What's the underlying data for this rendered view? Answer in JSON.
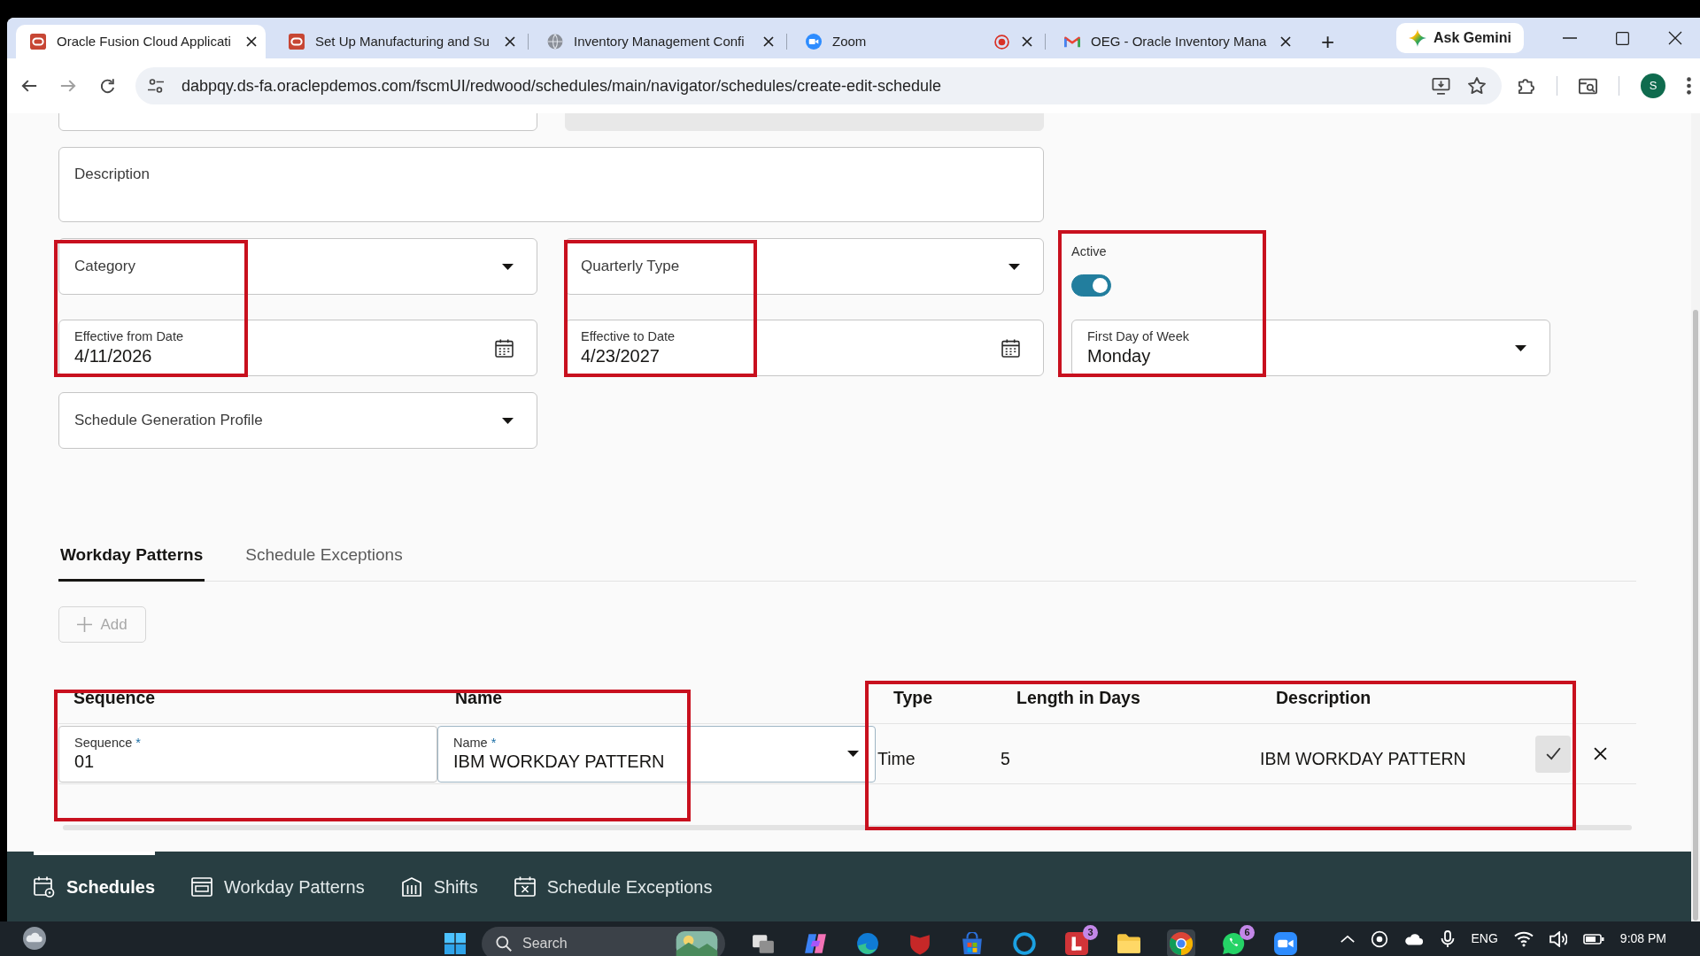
{
  "browser": {
    "tabs": [
      {
        "title": "Oracle Fusion Cloud Applicati",
        "kind": "oracle",
        "selected": true,
        "recording": false
      },
      {
        "title": "Set Up Manufacturing and Su",
        "kind": "oracle",
        "selected": false,
        "recording": false
      },
      {
        "title": "Inventory Management Confi",
        "kind": "globe",
        "selected": false,
        "recording": false
      },
      {
        "title": "Zoom",
        "kind": "zoom",
        "selected": false,
        "recording": true
      },
      {
        "title": "OEG - Oracle Inventory Mana",
        "kind": "mail",
        "selected": false,
        "recording": false
      }
    ],
    "new_tab": "+",
    "gemini_button": "Ask Gemini",
    "address": "dabpqy.ds-fa.oraclepdemos.com/fscmUI/redwood/schedules/main/navigator/schedules/create-edit-schedule",
    "profile_initial": "S"
  },
  "form": {
    "rows": [
      {
        "fields": [
          {
            "kind": "text",
            "disabled": false
          },
          {
            "kind": "text",
            "disabled": true
          }
        ]
      },
      {
        "fields": [
          {
            "kind": "textarea",
            "label": "Description"
          }
        ]
      },
      {
        "fields": [
          {
            "kind": "select",
            "label": "Category"
          },
          {
            "kind": "select",
            "label": "Quarterly Type"
          },
          {
            "kind": "toggle",
            "label": "Active",
            "on": true
          }
        ]
      },
      {
        "fields": [
          {
            "kind": "date",
            "label": "Effective from Date",
            "value": "4/11/2026"
          },
          {
            "kind": "date",
            "label": "Effective to Date",
            "value": "4/23/2027"
          },
          {
            "kind": "select",
            "label": "First Day of Week",
            "value": "Monday"
          }
        ]
      },
      {
        "fields": [
          {
            "kind": "select",
            "label": "Schedule Generation Profile"
          }
        ]
      }
    ]
  },
  "tabs": [
    {
      "label": "Workday Patterns",
      "selected": true
    },
    {
      "label": "Schedule Exceptions",
      "selected": false
    }
  ],
  "add_button": {
    "label": "Add",
    "disabled": true
  },
  "table": {
    "columns": [
      "Sequence",
      "Name",
      "Type",
      "Length in Days",
      "Description"
    ],
    "rows": [
      {
        "cells": [
          {
            "kind": "input",
            "label": "Sequence",
            "required_mark": "*",
            "value": "01"
          },
          {
            "kind": "select",
            "label": "Name",
            "required_mark": "*",
            "value": "IBM WORKDAY PATTERN"
          },
          {
            "kind": "text",
            "value": "Time"
          },
          {
            "kind": "text",
            "value": "5"
          },
          {
            "kind": "text",
            "value": "IBM WORKDAY PATTERN"
          }
        ]
      }
    ]
  },
  "bottom_nav": [
    {
      "label": "Schedules",
      "kind": "schedule",
      "selected": true
    },
    {
      "label": "Workday Patterns",
      "kind": "pattern",
      "selected": false
    },
    {
      "label": "Shifts",
      "kind": "shift",
      "selected": false
    },
    {
      "label": "Schedule Exceptions",
      "kind": "exception",
      "selected": false
    }
  ],
  "taskbar": {
    "search_placeholder": "Search",
    "apps": [
      {
        "kind": "taskview",
        "active": false
      },
      {
        "kind": "copilot",
        "active": false
      },
      {
        "kind": "edge",
        "active": false
      },
      {
        "kind": "shield",
        "active": false
      },
      {
        "kind": "store",
        "active": false
      },
      {
        "kind": "ring",
        "active": false
      },
      {
        "kind": "tile",
        "active": false,
        "badge": "3"
      },
      {
        "kind": "folder",
        "active": false
      },
      {
        "kind": "chrome",
        "active": true
      },
      {
        "kind": "chat",
        "active": false,
        "badge": "6"
      },
      {
        "kind": "meeting",
        "active": false
      }
    ],
    "language": "ENG",
    "time": "9:08 PM"
  }
}
